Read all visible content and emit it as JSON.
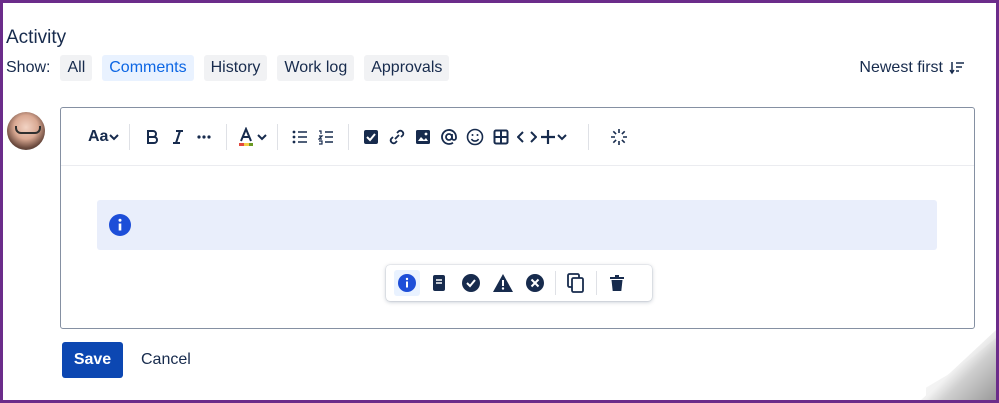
{
  "activity": {
    "title": "Activity",
    "show_label": "Show:",
    "filters": [
      "All",
      "Comments",
      "History",
      "Work log",
      "Approvals"
    ],
    "active_filter": "Comments",
    "sort_label": "Newest first"
  },
  "editor": {
    "toolbar": {
      "text_style_label": "Aa",
      "icons": [
        "text-style-icon",
        "bold-icon",
        "italic-icon",
        "more-formatting-icon",
        "text-color-icon",
        "bullet-list-icon",
        "numbered-list-icon",
        "checkbox-icon",
        "link-icon",
        "image-icon",
        "mention-icon",
        "emoji-icon",
        "table-icon",
        "code-icon",
        "insert-plus-icon",
        "ai-sparkle-icon"
      ]
    },
    "panel": {
      "type": "info"
    },
    "panel_toolbar": {
      "icons": [
        "info-icon",
        "note-icon",
        "success-icon",
        "warning-icon",
        "error-icon",
        "copy-icon",
        "delete-icon"
      ],
      "active": "info-icon"
    }
  },
  "actions": {
    "save_label": "Save",
    "cancel_label": "Cancel"
  },
  "colors": {
    "accent": "#0c66e4",
    "primary_button": "#0c47b2",
    "panel_bg": "#e9eefb",
    "frame": "#6b2c8a"
  }
}
